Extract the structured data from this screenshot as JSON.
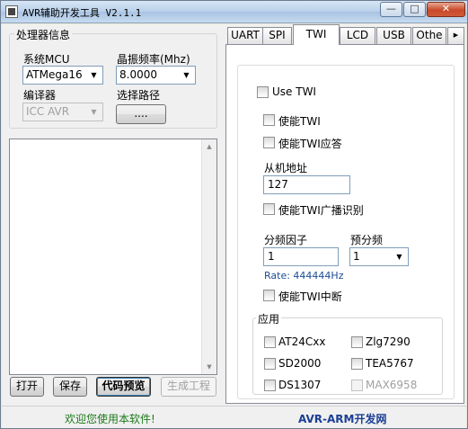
{
  "window": {
    "title": "AVR辅助开发工具 V2.1.1",
    "min_label": "—",
    "max_label": "□",
    "close_label": "✕"
  },
  "left": {
    "group_title": "处理器信息",
    "mcu_label": "系统MCU",
    "mcu_value": "ATMega16",
    "freq_label": "晶振频率(Mhz)",
    "freq_value": "8.0000",
    "compiler_label": "编译器",
    "compiler_value": "ICC AVR",
    "path_label": "选择路径",
    "path_button": "....",
    "buttons": {
      "open": "打开",
      "save": "保存",
      "preview": "代码预览",
      "generate": "生成工程"
    }
  },
  "tabs": [
    {
      "label": "UART"
    },
    {
      "label": "SPI"
    },
    {
      "label": "TWI"
    },
    {
      "label": "LCD"
    },
    {
      "label": "USB"
    },
    {
      "label": "Othe"
    }
  ],
  "twi": {
    "use_twi": "Use TWI",
    "enable_twi": "使能TWI",
    "enable_ack": "使能TWI应答",
    "slave_addr_label": "从机地址",
    "slave_addr_value": "127",
    "enable_broadcast": "使能TWI广播识别",
    "divider_label": "分频因子",
    "divider_value": "1",
    "prescale_label": "预分频",
    "prescale_value": "1",
    "rate": "Rate: 444444Hz",
    "enable_interrupt": "使能TWI中断",
    "app_group": "应用",
    "apps": {
      "at24": "AT24Cxx",
      "zlg": "Zlg7290",
      "sd2000": "SD2000",
      "tea": "TEA5767",
      "ds1307": "DS1307",
      "max": "MAX6958"
    }
  },
  "status": {
    "welcome": "欢迎您使用本软件!",
    "site": "AVR-ARM开发网"
  }
}
